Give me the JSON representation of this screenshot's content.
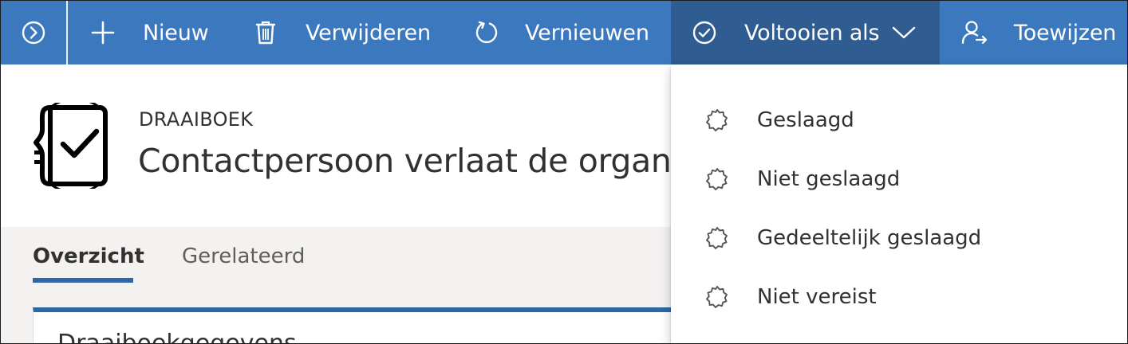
{
  "toolbar": {
    "new_label": "Nieuw",
    "delete_label": "Verwijderen",
    "refresh_label": "Vernieuwen",
    "complete_as_label": "Voltooien als",
    "assign_label": "Toewijzen"
  },
  "header": {
    "entity_type": "DRAAIBOEK",
    "title": "Contactpersoon verlaat de organis"
  },
  "tabs": [
    {
      "label": "Overzicht",
      "active": true
    },
    {
      "label": "Gerelateerd",
      "active": false
    }
  ],
  "section": {
    "title": "Draaiboekgegevens"
  },
  "dropdown": {
    "items": [
      {
        "label": "Geslaagd"
      },
      {
        "label": "Niet geslaagd"
      },
      {
        "label": "Gedeeltelijk geslaagd"
      },
      {
        "label": "Niet vereist"
      }
    ]
  },
  "colors": {
    "command_bar": "#3c78bd",
    "command_active": "#2f5d91",
    "tab_accent": "#2f66a6"
  },
  "icons": {
    "collapse": "chevron-circle-icon",
    "new": "plus-icon",
    "delete": "trash-icon",
    "refresh": "refresh-icon",
    "complete": "checkmark-circle-icon",
    "dropdown_chevron": "chevron-down-icon",
    "assign": "assign-person-icon",
    "entity": "playbook-checklist-icon",
    "dropdown_item": "badge-icon"
  }
}
